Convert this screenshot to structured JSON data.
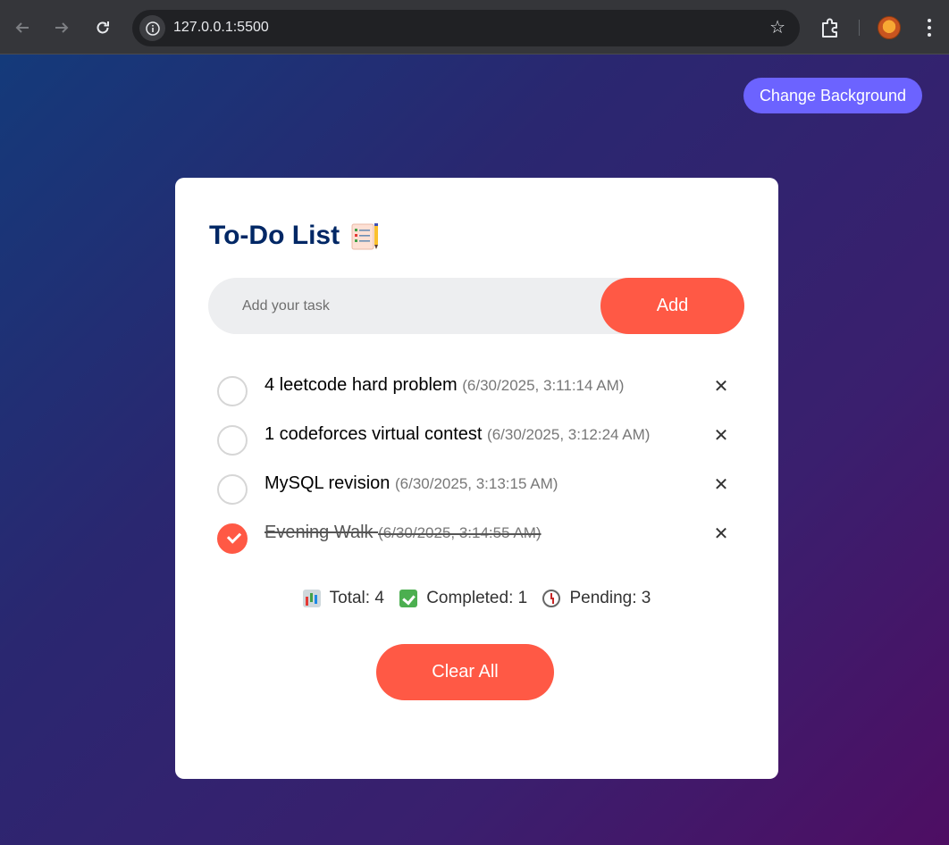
{
  "browser": {
    "url": "127.0.0.1:5500",
    "icons": [
      "back-arrow-icon",
      "forward-arrow-icon",
      "reload-icon",
      "site-info-icon",
      "bookmark-star-icon",
      "extensions-icon",
      "profile-avatar",
      "menu-icon"
    ]
  },
  "header": {
    "change_bg_label": "Change Background"
  },
  "todo": {
    "title": "To-Do List",
    "title_icon": "notepad-icon",
    "input_placeholder": "Add your task",
    "add_label": "Add",
    "tasks": [
      {
        "text": "4 leetcode hard problem",
        "time": "(6/30/2025, 3:11:14 AM)",
        "completed": false
      },
      {
        "text": "1 codeforces virtual contest",
        "time": "(6/30/2025, 3:12:24 AM)",
        "completed": false
      },
      {
        "text": "MySQL revision",
        "time": "(6/30/2025, 3:13:15 AM)",
        "completed": false
      },
      {
        "text": "Evening Walk",
        "time": "(6/30/2025, 3:14:55 AM)",
        "completed": true
      }
    ],
    "delete_glyph": "✕",
    "stats": {
      "total_label": "Total: 4",
      "completed_label": "Completed: 1",
      "pending_label": "Pending: 3"
    },
    "clear_label": "Clear All"
  },
  "colors": {
    "accent": "#ff5945",
    "bg_button": "#6c63ff",
    "title": "#002765"
  }
}
